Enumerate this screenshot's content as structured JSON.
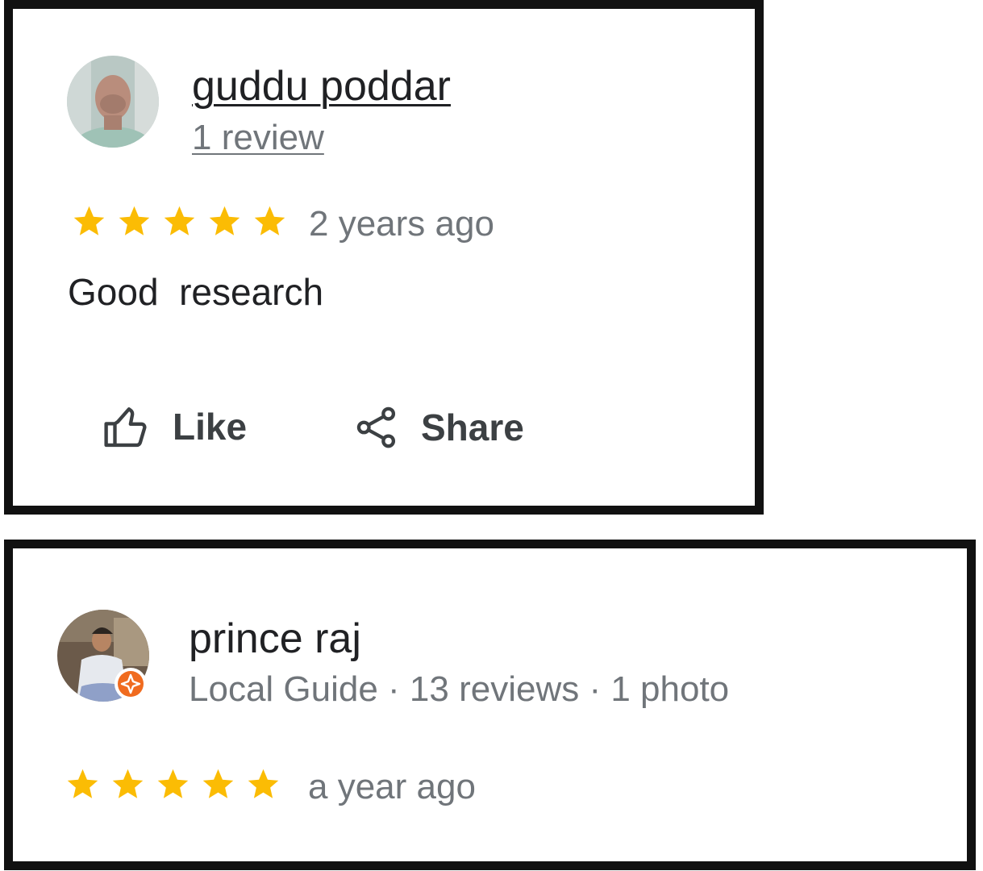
{
  "reviews": [
    {
      "name": "guddu poddar",
      "subtitle": "1 review",
      "rating": 5,
      "time": "2 years ago",
      "text": "Good  research",
      "actions": {
        "like": "Like",
        "share": "Share"
      }
    },
    {
      "name": "prince raj",
      "subtitle": "Local Guide · 13 reviews · 1 photo",
      "rating": 5,
      "time": "a year ago"
    }
  ],
  "colors": {
    "star": "#fbbc04",
    "local_guide_badge": "#f06b1f",
    "border": "#111111",
    "secondary_text": "#70757a"
  },
  "icons": {
    "like": "thumbs-up-icon",
    "share": "share-icon",
    "star": "star-icon",
    "badge": "local-guide-badge-icon"
  }
}
